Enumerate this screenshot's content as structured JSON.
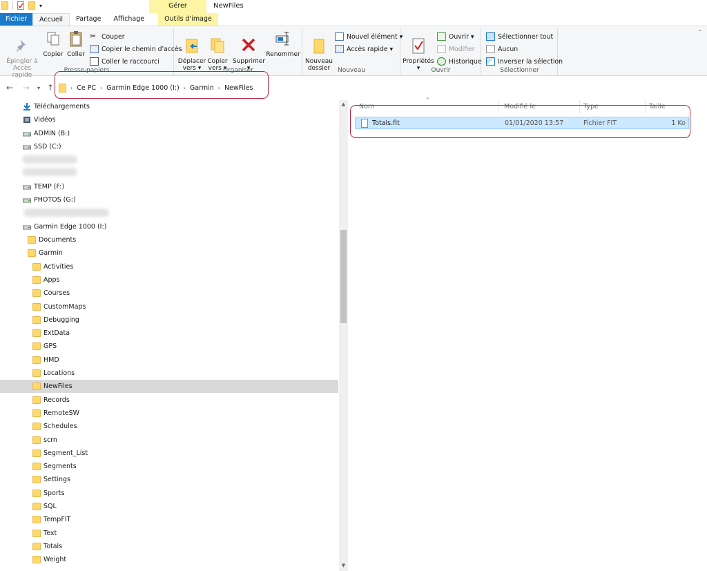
{
  "window": {
    "title": "NewFiles",
    "context_group": "Gérer"
  },
  "ribbon_tabs": [
    "Fichier",
    "Accueil",
    "Partage",
    "Affichage",
    "Outils d'image"
  ],
  "ribbon": {
    "clipboard": {
      "label": "Presse-papiers",
      "pin": "Épingler à\nAccès rapide",
      "copy": "Copier",
      "paste": "Coller",
      "cut": "Couper",
      "copy_path": "Copier le chemin d'accès",
      "paste_shortcut": "Coller le raccourci"
    },
    "organize": {
      "label": "Organiser",
      "move_to": "Déplacer\nvers ▾",
      "copy_to": "Copier\nvers ▾",
      "delete": "Supprimer\n▾",
      "rename": "Renommer"
    },
    "new": {
      "label": "Nouveau",
      "new_folder": "Nouveau\ndossier",
      "new_item": "Nouvel élément ▾",
      "easy_access": "Accès rapide ▾"
    },
    "open": {
      "label": "Ouvrir",
      "properties": "Propriétés\n▾",
      "open": "Ouvrir ▾",
      "edit": "Modifier",
      "history": "Historique"
    },
    "select": {
      "label": "Sélectionner",
      "select_all": "Sélectionner tout",
      "select_none": "Aucun",
      "invert": "Inverser la sélection"
    }
  },
  "breadcrumb": [
    "Ce PC",
    "Garmin Edge 1000 (I:)",
    "Garmin",
    "NewFiles"
  ],
  "tree": [
    {
      "label": "Téléchargements",
      "icon": "download-arrow-icon",
      "indent": 1
    },
    {
      "label": "Vidéos",
      "icon": "video-icon",
      "indent": 1
    },
    {
      "label": "ADMIN (B:)",
      "icon": "drive-icon",
      "indent": 1
    },
    {
      "label": "SSD (C:)",
      "icon": "system-drive-icon",
      "indent": 1
    },
    {
      "label": "TEMP (F:)",
      "icon": "network-drive-icon",
      "indent": 1
    },
    {
      "label": "PHOTOS (G:)",
      "icon": "drive-icon",
      "indent": 1
    },
    {
      "label": "Garmin Edge 1000 (I:)",
      "icon": "usb-drive-icon",
      "indent": 1
    },
    {
      "label": "Documents",
      "icon": "folder-icon",
      "indent": 2
    },
    {
      "label": "Garmin",
      "icon": "folder-icon",
      "indent": 2
    },
    {
      "label": "Activities",
      "icon": "folder-icon",
      "indent": 3
    },
    {
      "label": "Apps",
      "icon": "folder-icon",
      "indent": 3
    },
    {
      "label": "Courses",
      "icon": "folder-icon",
      "indent": 3
    },
    {
      "label": "CustomMaps",
      "icon": "folder-icon",
      "indent": 3
    },
    {
      "label": "Debugging",
      "icon": "folder-icon",
      "indent": 3
    },
    {
      "label": "ExtData",
      "icon": "folder-icon",
      "indent": 3
    },
    {
      "label": "GPS",
      "icon": "folder-icon",
      "indent": 3
    },
    {
      "label": "HMD",
      "icon": "folder-icon",
      "indent": 3
    },
    {
      "label": "Locations",
      "icon": "folder-icon",
      "indent": 3
    },
    {
      "label": "NewFiles",
      "icon": "folder-icon",
      "indent": 3,
      "selected": true
    },
    {
      "label": "Records",
      "icon": "folder-icon",
      "indent": 3
    },
    {
      "label": "RemoteSW",
      "icon": "folder-icon",
      "indent": 3
    },
    {
      "label": "Schedules",
      "icon": "folder-icon",
      "indent": 3
    },
    {
      "label": "scrn",
      "icon": "folder-icon",
      "indent": 3
    },
    {
      "label": "Segment_List",
      "icon": "folder-icon",
      "indent": 3
    },
    {
      "label": "Segments",
      "icon": "folder-icon",
      "indent": 3
    },
    {
      "label": "Settings",
      "icon": "folder-icon",
      "indent": 3
    },
    {
      "label": "Sports",
      "icon": "folder-icon",
      "indent": 3
    },
    {
      "label": "SQL",
      "icon": "folder-icon",
      "indent": 3
    },
    {
      "label": "TempFIT",
      "icon": "folder-icon",
      "indent": 3
    },
    {
      "label": "Text",
      "icon": "folder-icon",
      "indent": 3
    },
    {
      "label": "Totals",
      "icon": "folder-icon",
      "indent": 3
    },
    {
      "label": "Weight",
      "icon": "folder-icon",
      "indent": 3
    }
  ],
  "file_columns": [
    "Nom",
    "Modifié le",
    "Type",
    "Taille"
  ],
  "files": [
    {
      "name": "Totals.fit",
      "modified": "01/01/2020 13:57",
      "type": "Fichier FIT",
      "size": "1 Ko"
    }
  ],
  "colors": {
    "accent": "#1979ca",
    "highlight": "#b8253a",
    "selection": "#cce8ff",
    "context_tab": "#fdf5a3"
  }
}
